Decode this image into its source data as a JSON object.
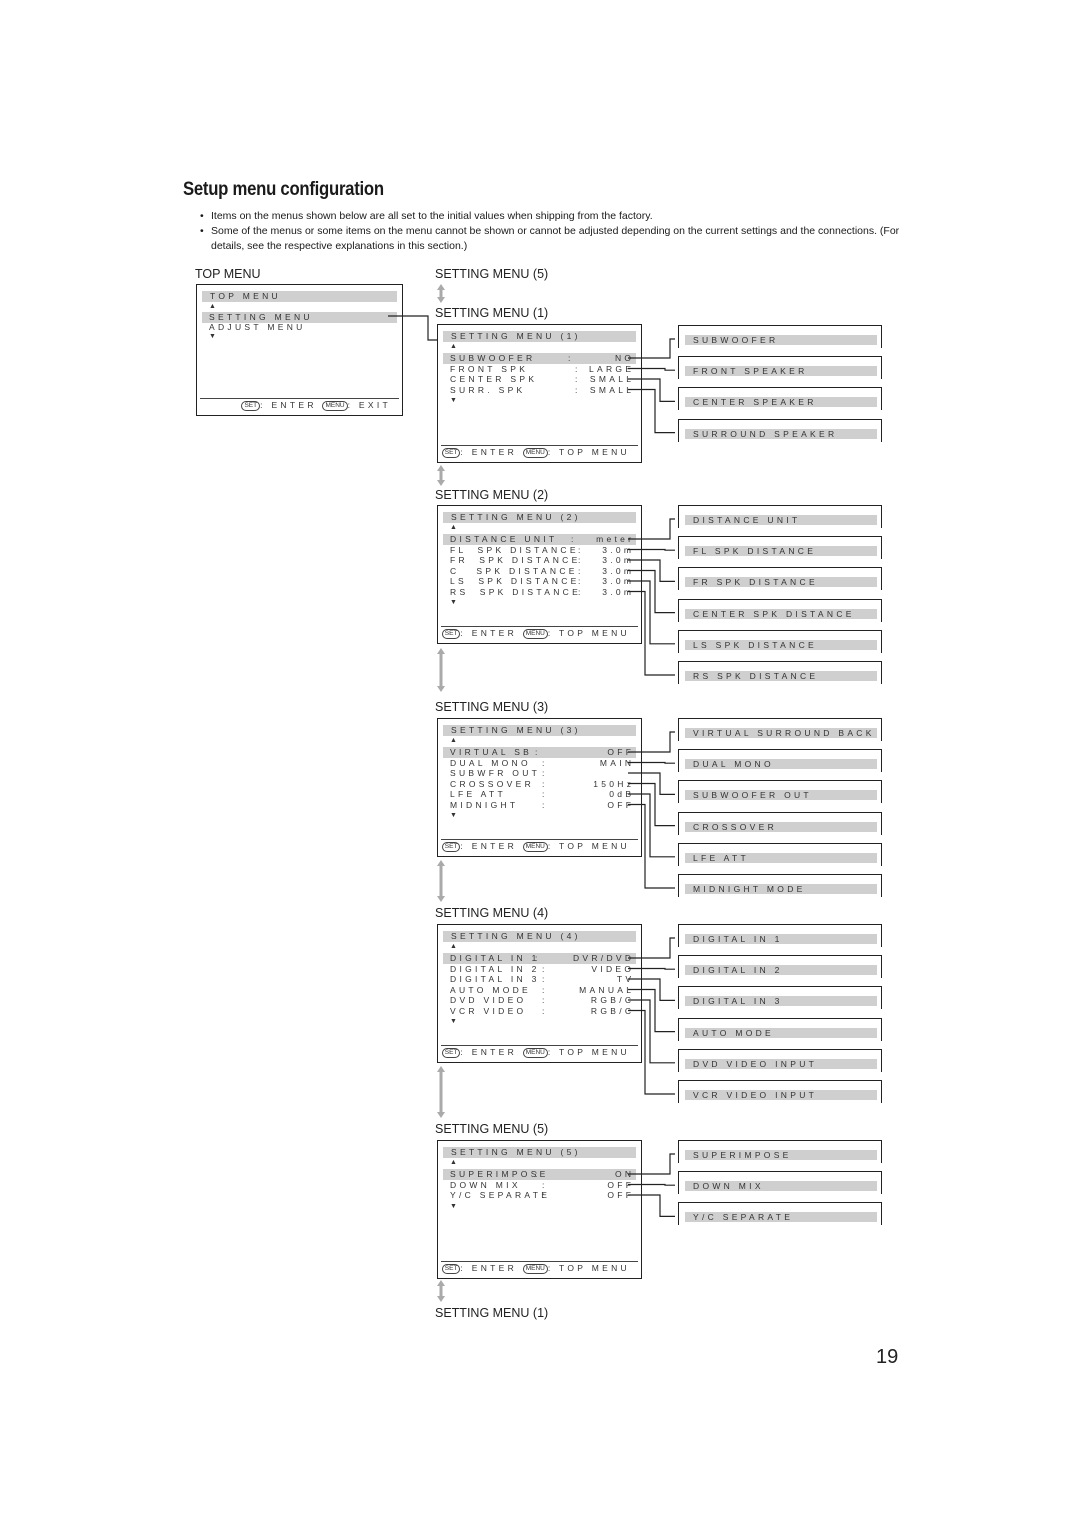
{
  "title": "Setup menu configuration",
  "bullets": [
    "Items on the menus shown below are all set to the initial values when shipping from the factory.",
    "Some of the menus or some items on the menu cannot be shown or cannot be adjusted depending on the current settings and the connections. (For details, see the respective explanations in this section.)"
  ],
  "top_menu": {
    "caption": "TOP MENU",
    "header": "TOP MENU",
    "items": [
      "SETTING MENU",
      "ADJUST MENU"
    ],
    "footer_set": "SET",
    "footer_enter": ": ENTER",
    "footer_menu": "MENU",
    "footer_exit": ": EXIT"
  },
  "footer": {
    "set_btn": "SET",
    "enter": ": ENTER",
    "menu_btn": "MENU",
    "top_menu": ": TOP MENU"
  },
  "captions": {
    "sm5_top": "SETTING MENU (5)",
    "sm1": "SETTING MENU (1)",
    "sm2": "SETTING MENU (2)",
    "sm3": "SETTING MENU (3)",
    "sm4": "SETTING MENU (4)",
    "sm5": "SETTING MENU (5)",
    "sm1_bottom": "SETTING MENU (1)"
  },
  "setting_menus": [
    {
      "header": "SETTING MENU (1)",
      "items": [
        {
          "label": "SUBWOOFER",
          "value": "NO",
          "submenu": "SUBWOOFER"
        },
        {
          "label": "FRONT SPK",
          "value": "LARGE",
          "submenu": "FRONT SPEAKER"
        },
        {
          "label": "CENTER SPK",
          "value": "SMALL",
          "submenu": "CENTER SPEAKER"
        },
        {
          "label": "SURR. SPK",
          "value": "SMALL",
          "submenu": "SURROUND SPEAKER"
        }
      ]
    },
    {
      "header": "SETTING MENU (2)",
      "items": [
        {
          "label": "DISTANCE UNIT",
          "value": "meter",
          "submenu": "DISTANCE UNIT"
        },
        {
          "label": "FL  SPK DISTANCE",
          "value": "3.0m",
          "submenu": "FL SPK DISTANCE"
        },
        {
          "label": "FR  SPK DISTANCE",
          "value": "3.0m",
          "submenu": "FR SPK DISTANCE"
        },
        {
          "label": "C   SPK DISTANCE",
          "value": "3.0m",
          "submenu": "CENTER SPK DISTANCE"
        },
        {
          "label": "LS  SPK DISTANCE",
          "value": "3.0m",
          "submenu": "LS SPK DISTANCE"
        },
        {
          "label": "RS  SPK DISTANCE",
          "value": "3.0m",
          "submenu": "RS SPK DISTANCE"
        }
      ]
    },
    {
      "header": "SETTING MENU (3)",
      "items": [
        {
          "label": "VIRTUAL SB",
          "value": "OFF",
          "submenu": "VIRTUAL SURROUND BACK"
        },
        {
          "label": "DUAL MONO",
          "value": "MAIN",
          "submenu": "DUAL MONO"
        },
        {
          "label": "SUBWFR OUT",
          "value": "",
          "submenu": "SUBWOOFER OUT"
        },
        {
          "label": "CROSSOVER",
          "value": "150Hz",
          "submenu": "CROSSOVER"
        },
        {
          "label": "LFE ATT",
          "value": "0dB",
          "submenu": "LFE ATT"
        },
        {
          "label": "MIDNIGHT",
          "value": "OFF",
          "submenu": "MIDNIGHT MODE"
        }
      ]
    },
    {
      "header": "SETTING MENU (4)",
      "items": [
        {
          "label": "DIGITAL IN 1",
          "value": "DVR/DVD",
          "submenu": "DIGITAL IN 1"
        },
        {
          "label": "DIGITAL IN 2",
          "value": "VIDEO",
          "submenu": "DIGITAL IN 2"
        },
        {
          "label": "DIGITAL IN 3",
          "value": "TV",
          "submenu": "DIGITAL IN 3"
        },
        {
          "label": "AUTO MODE",
          "value": "MANUAL",
          "submenu": "AUTO MODE"
        },
        {
          "label": "DVD VIDEO",
          "value": "RGB/C",
          "submenu": "DVD VIDEO INPUT"
        },
        {
          "label": "VCR VIDEO",
          "value": "RGB/C",
          "submenu": "VCR VIDEO INPUT"
        }
      ]
    },
    {
      "header": "SETTING MENU (5)",
      "items": [
        {
          "label": "SUPERIMPOSE",
          "value": "ON",
          "submenu": "SUPERIMPOSE"
        },
        {
          "label": "DOWN MIX",
          "value": "OFF",
          "submenu": "DOWN MIX"
        },
        {
          "label": "Y/C SEPARATE",
          "value": "OFF",
          "submenu": "Y/C SEPARATE"
        }
      ]
    }
  ],
  "page_number": "19"
}
